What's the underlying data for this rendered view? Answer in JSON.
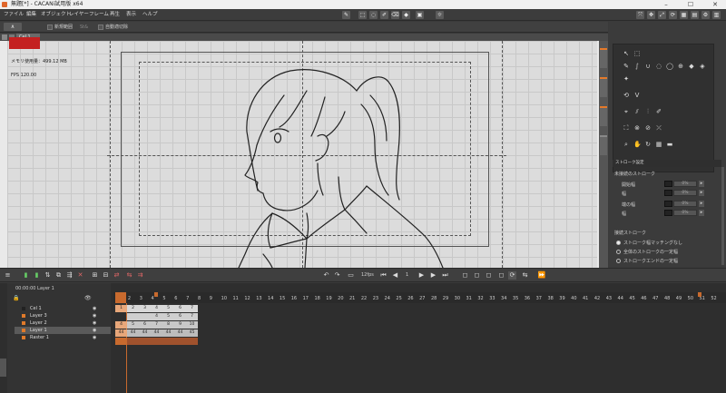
{
  "window": {
    "title": "無題[*] - CACANi試用版 x64",
    "min": "–",
    "max": "☐",
    "close": "✕"
  },
  "menu": [
    "ファイル",
    "編集",
    "オブジェクト",
    "レイヤー",
    "フレーム",
    "再生",
    "表示",
    "ヘルプ"
  ],
  "subtoolbar": {
    "btn1": "新規範囲",
    "btn2": "St&",
    "btn3": "自動適切除"
  },
  "canvas": {
    "tab_label": "Cel 1",
    "warning_text": "",
    "memory_label": "メモリ使用量：499.12 MB",
    "fps_label": "FPS 120.00"
  },
  "properties": {
    "header": "ストローク設定",
    "section1": "未接続のストローク",
    "start_width": "開始幅",
    "width_a": "幅",
    "end_width": "端の幅",
    "width_b": "幅",
    "value_placeholder": "0%",
    "section2": "接続ストローク",
    "opt1": "ストローク幅マッチングなし",
    "opt2": "全体のストロークの一定幅",
    "opt3": "ストロークエンドの一定幅"
  },
  "playback": {
    "fps": "12fps",
    "frame": "1"
  },
  "timeline": {
    "time_label": "00:00:00 Layer 1",
    "layers": [
      {
        "name": "Cel 1",
        "color": "#222222"
      },
      {
        "name": "Layer 3",
        "color": "#e07a2a"
      },
      {
        "name": "Layer 2",
        "color": "#e07a2a"
      },
      {
        "name": "Layer 1",
        "color": "#e07a2a"
      },
      {
        "name": "Raster 1",
        "color": "#e07a2a"
      }
    ],
    "frame_numbers": [
      "1",
      "2",
      "3",
      "4",
      "5",
      "6",
      "7",
      "8",
      "9",
      "10",
      "11",
      "12",
      "13",
      "14",
      "15",
      "16",
      "17",
      "18",
      "19",
      "20",
      "21",
      "22",
      "23",
      "24",
      "25",
      "26",
      "27",
      "28",
      "29",
      "30",
      "31",
      "32",
      "33",
      "34",
      "35",
      "36",
      "37",
      "38",
      "39",
      "40",
      "41",
      "42",
      "43",
      "44",
      "45",
      "46",
      "47",
      "48",
      "49",
      "50",
      "51",
      "52"
    ],
    "cells_row_cel": [
      "1",
      "2",
      "3",
      "4",
      "5",
      "6",
      "7"
    ],
    "cells_row_layer3": [
      "",
      "",
      "4",
      "5",
      "6",
      "7"
    ],
    "cells_row_layer2": [
      "4",
      "5",
      "6",
      "7",
      "8",
      "9",
      "10"
    ],
    "cells_row_layer1": [
      "44",
      "44",
      "44",
      "44",
      "44",
      "44",
      "45"
    ]
  }
}
